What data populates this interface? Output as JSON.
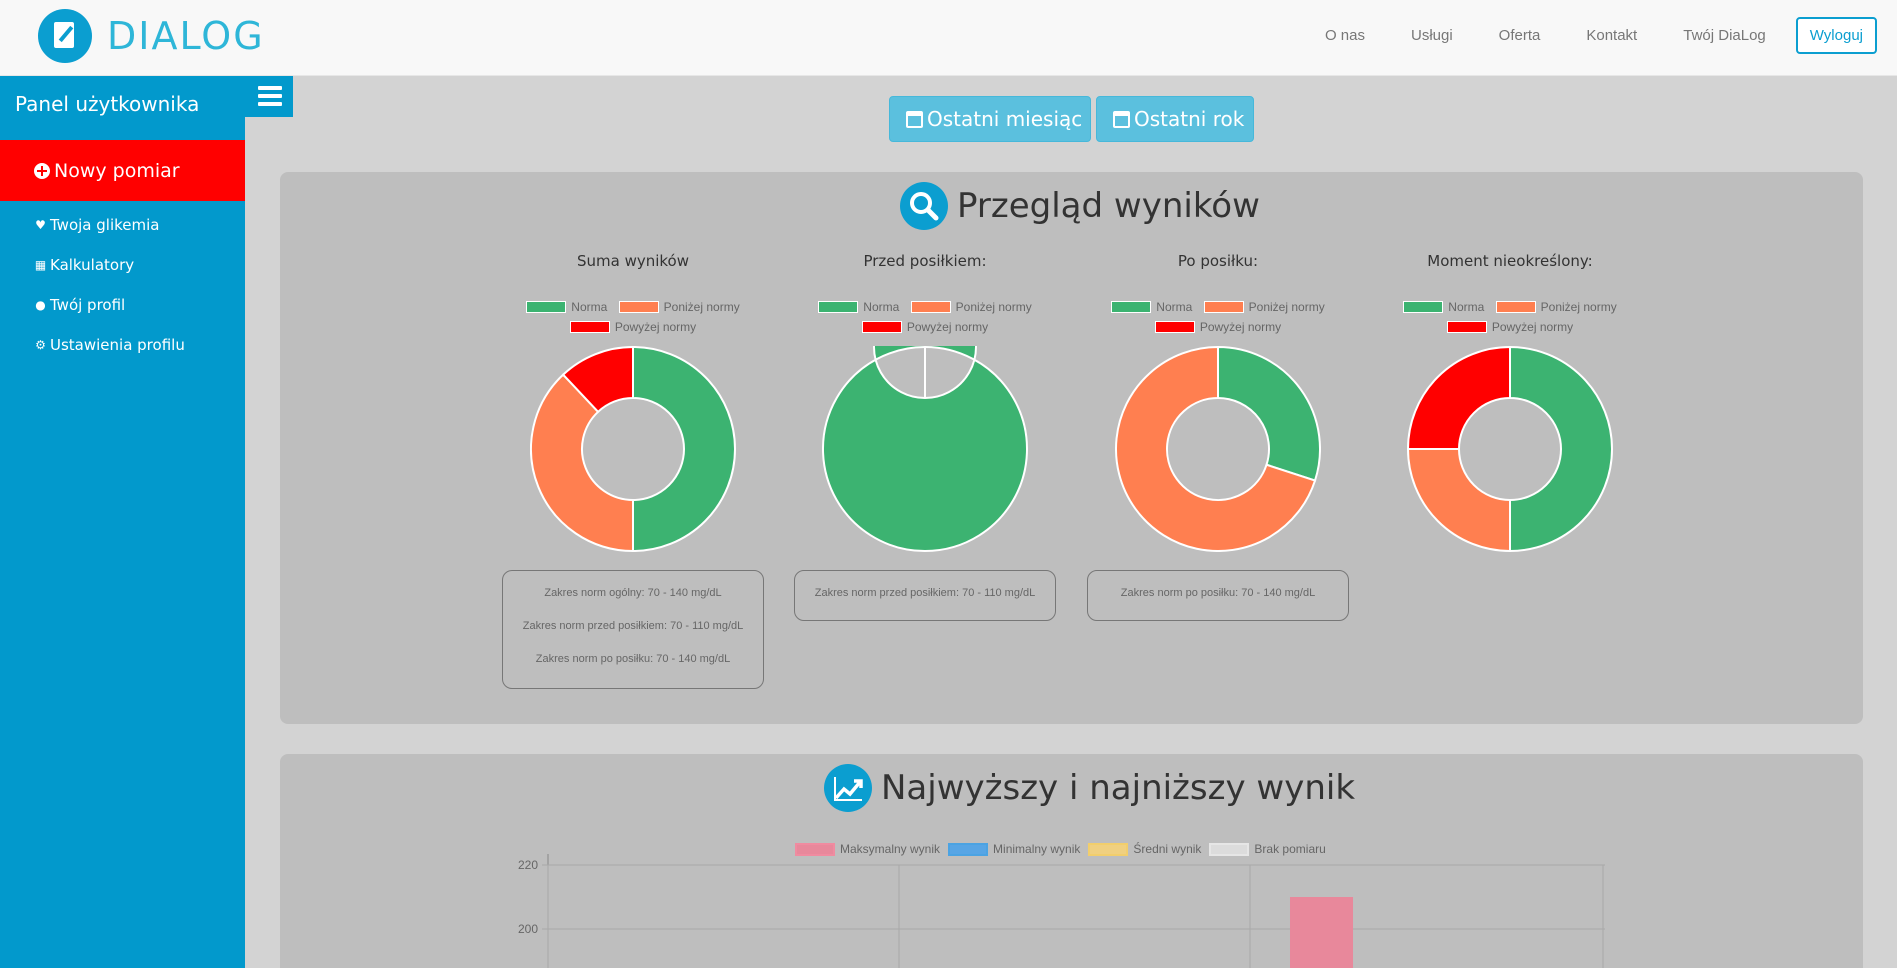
{
  "nav": {
    "brand": "DIALOG",
    "links": [
      "O nas",
      "Usługi",
      "Oferta",
      "Kontakt",
      "Twój DiaLog"
    ],
    "logout": "Wyloguj"
  },
  "sidebar": {
    "title": "Panel użytkownika",
    "new_measure": "Nowy pomiar",
    "items": [
      {
        "label": "Twoja glikemia",
        "icon": "heartbeat-icon"
      },
      {
        "label": "Kalkulatory",
        "icon": "calculator-icon"
      },
      {
        "label": "Twój profil",
        "icon": "user-icon"
      },
      {
        "label": "Ustawienia profilu",
        "icon": "cog-icon"
      }
    ]
  },
  "filters": {
    "month": "Ostatni miesiąc",
    "year": "Ostatni rok"
  },
  "overview": {
    "title": "Przegląd wyników",
    "legend": {
      "norm": "Norma",
      "below": "Poniżej normy",
      "above": "Powyżej normy"
    },
    "charts": [
      {
        "title": "Suma wyników",
        "notes": [
          "Zakres norm ogólny: 70 - 140 mg/dL",
          "Zakres norm przed posiłkiem: 70 - 110 mg/dL",
          "Zakres norm po posiłku: 70 - 140 mg/dL"
        ]
      },
      {
        "title": "Przed posiłkiem:",
        "notes": [
          "Zakres norm przed posiłkiem: 70 - 110 mg/dL"
        ]
      },
      {
        "title": "Po posiłku:",
        "notes": [
          "Zakres norm po posiłku: 70 - 140 mg/dL"
        ]
      },
      {
        "title": "Moment nieokreślony:",
        "notes": []
      }
    ]
  },
  "extremes": {
    "title": "Najwyższy i najniższy wynik",
    "legend": [
      "Maksymalny wynik",
      "Minimalny wynik",
      "Średni wynik",
      "Brak pomiaru"
    ]
  },
  "colors": {
    "norm": "#3cb371",
    "below": "#ff7f50",
    "above": "#ff0000",
    "max": "#e8889b",
    "min": "#57a5e5",
    "avg": "#f0d080",
    "none": "#dcdcdc"
  },
  "chart_data": [
    {
      "type": "pie",
      "title": "Suma wyników",
      "categories": [
        "Norma",
        "Poniżej normy",
        "Powyżej normy"
      ],
      "values": [
        50,
        38,
        12
      ],
      "donut": true
    },
    {
      "type": "pie",
      "title": "Przed posiłkiem:",
      "categories": [
        "Norma",
        "Poniżej normy",
        "Powyżej normy"
      ],
      "values": [
        100,
        0,
        0
      ],
      "donut": true
    },
    {
      "type": "pie",
      "title": "Po posiłku:",
      "categories": [
        "Norma",
        "Poniżej normy",
        "Powyżej normy"
      ],
      "values": [
        30,
        70,
        0
      ],
      "donut": true
    },
    {
      "type": "pie",
      "title": "Moment nieokreślony:",
      "categories": [
        "Norma",
        "Poniżej normy",
        "Powyżej normy"
      ],
      "values": [
        50,
        25,
        25
      ],
      "donut": true
    },
    {
      "type": "bar",
      "title": "Najwyższy i najniższy wynik",
      "series": [
        {
          "name": "Maksymalny wynik",
          "values": [
            null,
            null,
            210
          ]
        }
      ],
      "yticks": [
        220,
        200
      ],
      "ylim": [
        180,
        220
      ]
    }
  ]
}
